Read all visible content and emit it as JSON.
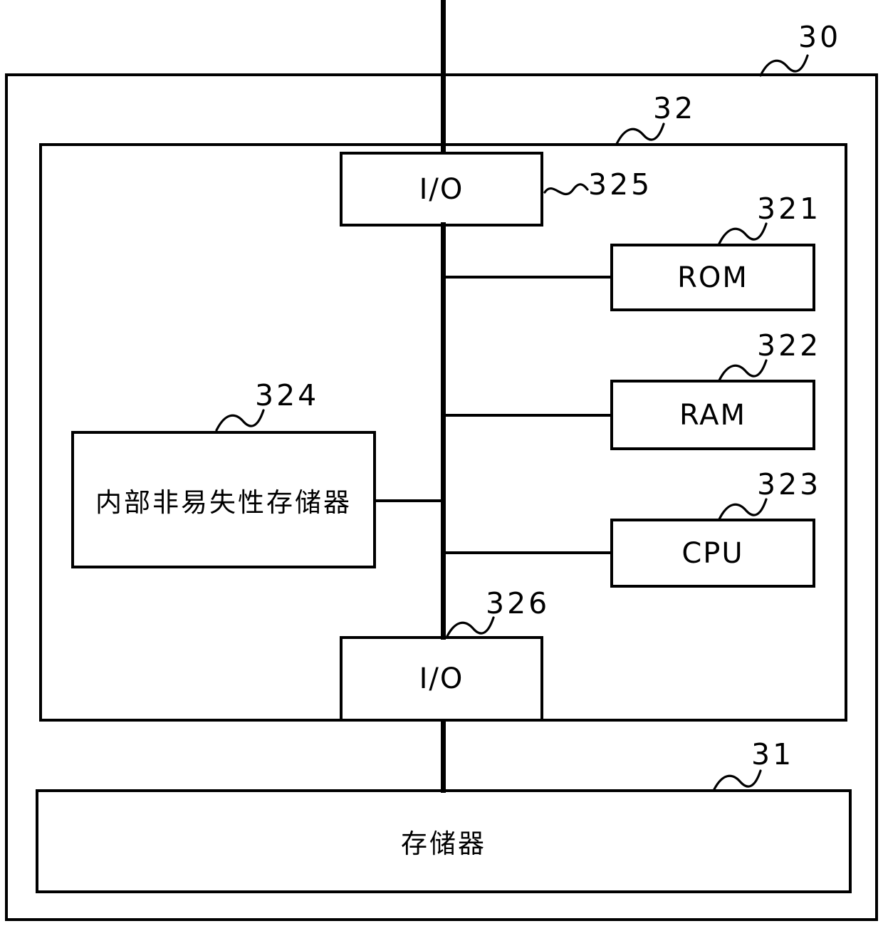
{
  "figure": {
    "type": "patent-block-diagram",
    "language": "zh-CN",
    "background_color": "#ffffff",
    "line_color": "#000000"
  },
  "outer_enclosure": {
    "ref": "30",
    "name": "outer-device-enclosure"
  },
  "inner_enclosure": {
    "ref": "32",
    "name": "controller-enclosure"
  },
  "blocks": {
    "io_top": {
      "label": "I/O",
      "ref": "325"
    },
    "rom": {
      "label": "ROM",
      "ref": "321"
    },
    "ram": {
      "label": "RAM",
      "ref": "322"
    },
    "cpu": {
      "label": "CPU",
      "ref": "323"
    },
    "nvm": {
      "label": "内部非易失性存储器",
      "ref": "324"
    },
    "io_bottom": {
      "label": "I/O",
      "ref": "326"
    },
    "memory": {
      "label": "存储器",
      "ref": "31"
    }
  }
}
